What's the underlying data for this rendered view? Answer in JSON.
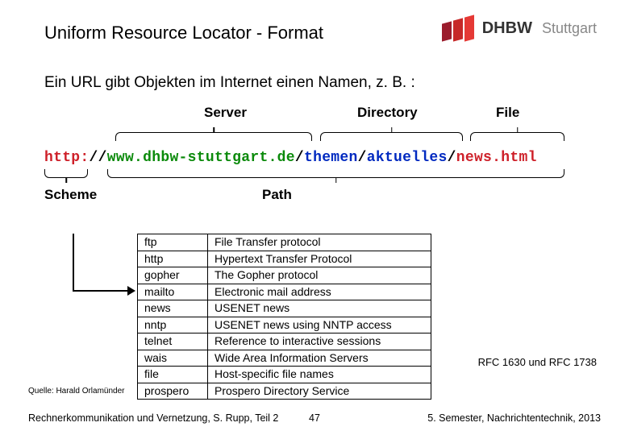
{
  "logo": {
    "brand": "DHBW",
    "campus": "Stuttgart"
  },
  "title": "Uniform Resource Locator - Format",
  "intro": "Ein URL gibt Objekten im Internet einen Namen, z. B. :",
  "labels": {
    "server": "Server",
    "directory": "Directory",
    "file": "File",
    "scheme": "Scheme",
    "path": "Path"
  },
  "url": {
    "scheme": "http:",
    "sep1": "//",
    "host": "www.dhbw-stuttgart.de",
    "sep2": "/",
    "dir1": "themen",
    "sep3": "/",
    "dir2": "aktuelles",
    "sep4": "/",
    "file": "news.html"
  },
  "protocols": [
    {
      "name": "ftp",
      "desc": "File Transfer protocol"
    },
    {
      "name": "http",
      "desc": "Hypertext Transfer Protocol"
    },
    {
      "name": "gopher",
      "desc": "The Gopher protocol"
    },
    {
      "name": "mailto",
      "desc": "Electronic mail address"
    },
    {
      "name": "news",
      "desc": "USENET news"
    },
    {
      "name": "nntp",
      "desc": "USENET news using NNTP access"
    },
    {
      "name": "telnet",
      "desc": "Reference to interactive sessions"
    },
    {
      "name": "wais",
      "desc": "Wide Area Information Servers"
    },
    {
      "name": "file",
      "desc": "Host-specific file names"
    },
    {
      "name": "prospero",
      "desc": "Prospero Directory Service"
    }
  ],
  "rfc": "RFC 1630 und RFC 1738",
  "source": "Quelle: Harald Orlamünder",
  "footer": {
    "left": "Rechnerkommunikation und Vernetzung, S. Rupp, Teil 2",
    "page": "47",
    "right": "5. Semester, Nachrichtentechnik, 2013"
  }
}
